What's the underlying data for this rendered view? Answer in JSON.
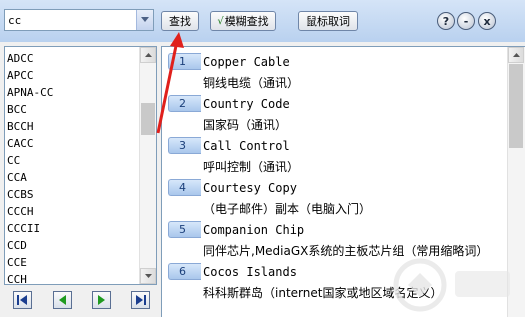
{
  "search": {
    "value": "cc"
  },
  "toolbar": {
    "find_label": "查找",
    "fuzzy_check": "√",
    "fuzzy_label": "模糊查找",
    "mouse_label": "鼠标取词",
    "help_label": "?",
    "minimize_label": "-",
    "close_label": "x"
  },
  "wordlist": {
    "items": [
      "ADCC",
      "APCC",
      "APNA-CC",
      "BCC",
      "BCCH",
      "CACC",
      "CC",
      "CCA",
      "CCBS",
      "CCCH",
      "CCCII",
      "CCD",
      "CCE",
      "CCH"
    ]
  },
  "definitions": [
    {
      "num": "1",
      "term": "Copper Cable",
      "def": "铜线电缆（通讯）"
    },
    {
      "num": "2",
      "term": "Country Code",
      "def": "国家码（通讯）"
    },
    {
      "num": "3",
      "term": "Call Control",
      "def": "呼叫控制（通讯）"
    },
    {
      "num": "4",
      "term": "Courtesy Copy",
      "def": "（电子邮件）副本（电脑入门）"
    },
    {
      "num": "5",
      "term": "Companion Chip",
      "def": "同伴芯片,MediaGX系统的主板芯片组（常用缩略词）"
    },
    {
      "num": "6",
      "term": "Cocos Islands",
      "def": "科科斯群岛（internet国家或地区域名定义）"
    }
  ],
  "icons": {
    "nav": [
      "first-icon",
      "prev-icon",
      "next-icon",
      "last-icon"
    ]
  },
  "colors": {
    "accent": "#1c7a1c",
    "arrow": "#e0201c",
    "tab": "#a9c7ec"
  }
}
